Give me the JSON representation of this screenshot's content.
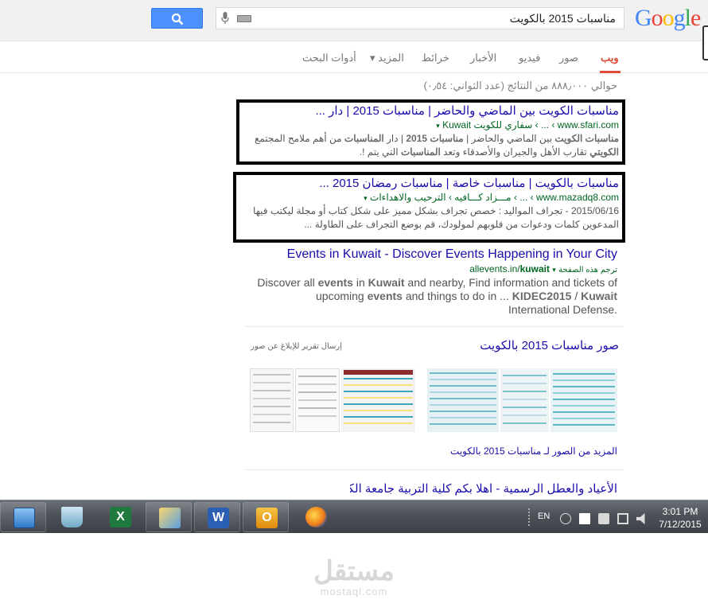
{
  "header": {
    "logo_text": "Google",
    "query": "مناسبات 2015 بالكويت"
  },
  "tabs": [
    {
      "label": "ويب"
    },
    {
      "label": "صور"
    },
    {
      "label": "فيديو"
    },
    {
      "label": "الأخبار"
    },
    {
      "label": "خرائط"
    },
    {
      "label": "المزيد ▾"
    },
    {
      "label": "أدوات البحث"
    }
  ],
  "stats": "حوالي ٨٨٨٫٠٠٠ من النتائج (عدد الثواني: ٠٫٥٤)",
  "results": [
    {
      "title": "مناسبات الكويت بين الماضي والحاضر | مناسبات 2015 | دار ...",
      "url": "www.sfari.com › ... › سفاري للكويت Kuwait",
      "snippet_parts": [
        {
          "b": "مناسبات الكويت"
        },
        {
          "t": " بين الماضي والحاضر | "
        },
        {
          "b": "مناسبات 2015"
        },
        {
          "t": " | دار "
        },
        {
          "b": "المناسبات"
        },
        {
          "t": " من أهم ملامح المجتمع "
        },
        {
          "b": "الكويتي"
        },
        {
          "t": " تقارب الأهل والجيران والأصدقاء وتعد "
        },
        {
          "b": "المناسبات"
        },
        {
          "t": " التي يتم !."
        }
      ]
    },
    {
      "title": "مناسبات بالكويت | مناسبات خاصة | مناسبات رمضان 2015 ...",
      "url": "www.mazadq8.com › ... › مـــزاد كـــافيه › الترحيب والاهداءات",
      "snippet_parts": [
        {
          "t": "2015/06/16 - تجراف المواليد : خصص تجراف بشكل مميز على شكل كتاب أو مجلة ليكتب فيها المدعوين كلمات ودعوات من قلوبهم لمولودك، قم بوضع التجراف على الطاولة ..."
        }
      ]
    },
    {
      "title": "Events in Kuwait - Discover Events Happening in Your City",
      "url_host": "allevents.in/",
      "url_path": "kuwait",
      "url_translate": "ترجم هذه الصفحة",
      "snippet_parts": [
        {
          "t": "Discover all "
        },
        {
          "b": "events"
        },
        {
          "t": " in "
        },
        {
          "b": "Kuwait"
        },
        {
          "t": " and nearby, Find information and tickets of upcoming "
        },
        {
          "b": "events"
        },
        {
          "t": " and things to do in ... "
        },
        {
          "b": "KIDEC2015"
        },
        {
          "t": " / "
        },
        {
          "b": "Kuwait"
        },
        {
          "t": " International Defense."
        }
      ]
    }
  ],
  "images": {
    "heading": "صور مناسبات 2015 بالكويت",
    "report": "إرسال تقرير للإبلاغ عن صور",
    "more": "المزيد من الصور لـ مناسبات 2015 بالكويت"
  },
  "last_result_title": "الأعياد والعطل الرسمية - اهلا بكم كلية التربية جامعة الكويت...",
  "taskbar": {
    "language": "EN",
    "time": "3:01 PM",
    "date": "7/12/2015"
  },
  "watermark": {
    "arabic": "مستقل",
    "latin": "mostaql.com"
  },
  "colors": {
    "link": "#1a0dab",
    "url_green": "#006621",
    "active_tab": "#dd4b39",
    "search_button": "#4d90fe"
  }
}
